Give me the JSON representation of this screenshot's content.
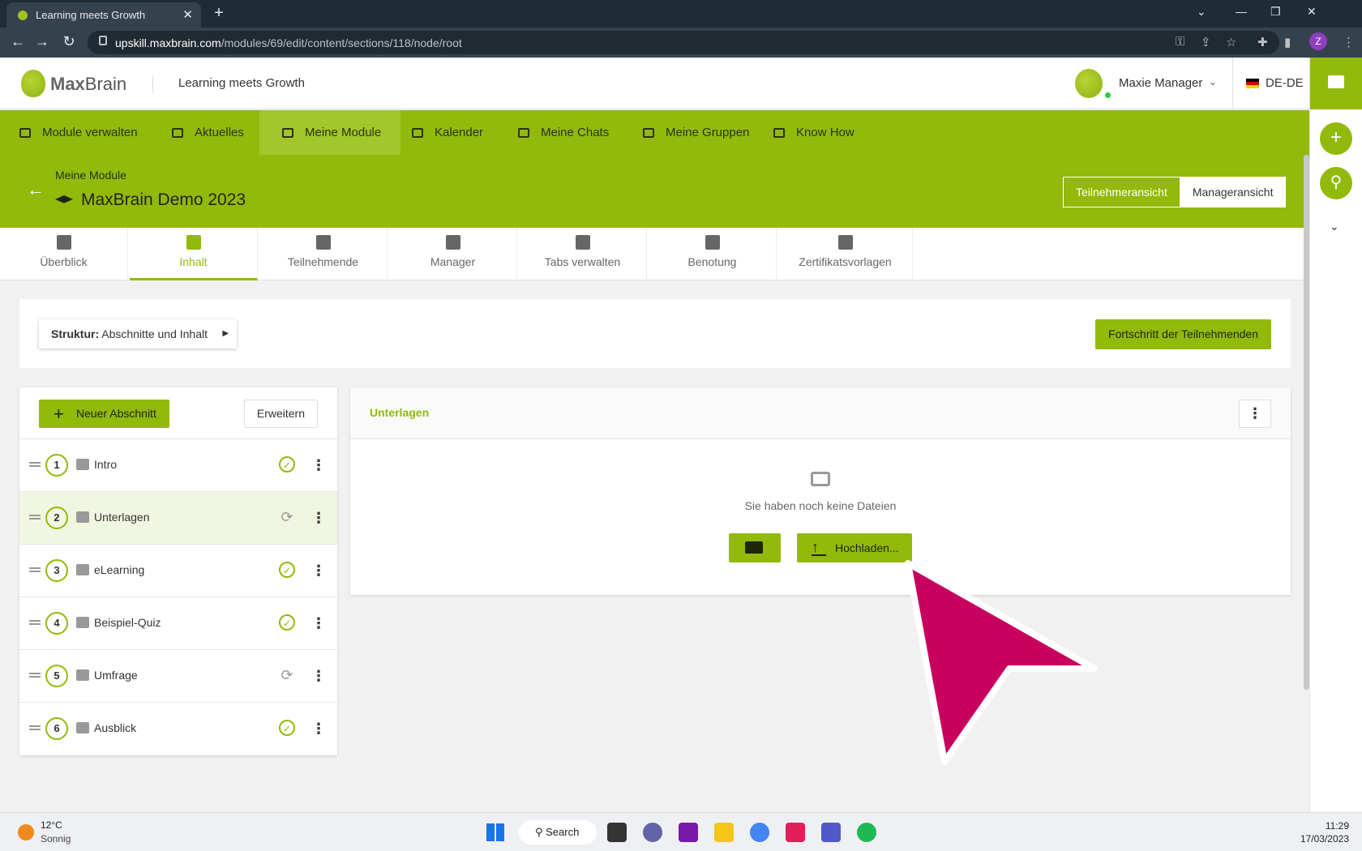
{
  "browser": {
    "tab_title": "Learning meets Growth",
    "url_host": "upskill.maxbrain.com",
    "url_path": "/modules/69/edit/content/sections/118/node/root",
    "profile_initial": "Z"
  },
  "header": {
    "brand_bold": "Max",
    "brand_light": "Brain",
    "subtitle": "Learning meets Growth",
    "user_name": "Maxie Manager",
    "language": "DE-DE"
  },
  "nav": {
    "items": [
      {
        "label": "Module verwalten"
      },
      {
        "label": "Aktuelles"
      },
      {
        "label": "Meine Module"
      },
      {
        "label": "Kalender"
      },
      {
        "label": "Meine Chats"
      },
      {
        "label": "Meine Gruppen"
      },
      {
        "label": "Know How"
      }
    ]
  },
  "module": {
    "breadcrumb": "Meine Module",
    "title": "MaxBrain Demo 2023",
    "view_participant": "Teilnehmeransicht",
    "view_manager": "Manageransicht"
  },
  "tabs": [
    {
      "label": "Überblick"
    },
    {
      "label": "Inhalt"
    },
    {
      "label": "Teilnehmende"
    },
    {
      "label": "Manager"
    },
    {
      "label": "Tabs verwalten"
    },
    {
      "label": "Benotung"
    },
    {
      "label": "Zertifikatsvorlagen"
    }
  ],
  "structure": {
    "label_bold": "Struktur:",
    "label_value": "Abschnitte und Inhalt",
    "progress_button": "Fortschritt der Teilnehmenden"
  },
  "sections": {
    "new_button": "Neuer Abschnitt",
    "expand_button": "Erweitern",
    "items": [
      {
        "num": "1",
        "label": "Intro",
        "status": "done"
      },
      {
        "num": "2",
        "label": "Unterlagen",
        "status": "sync"
      },
      {
        "num": "3",
        "label": "eLearning",
        "status": "done"
      },
      {
        "num": "4",
        "label": "Beispiel-Quiz",
        "status": "done"
      },
      {
        "num": "5",
        "label": "Umfrage",
        "status": "sync"
      },
      {
        "num": "6",
        "label": "Ausblick",
        "status": "done"
      }
    ]
  },
  "detail": {
    "title": "Unterlagen",
    "empty_text": "Sie haben noch keine Dateien",
    "upload_button": "Hochladen..."
  },
  "taskbar": {
    "temperature": "12°C",
    "weather": "Sonnig",
    "search": "Search",
    "time": "11:29",
    "date": "17/03/2023"
  },
  "colors": {
    "accent": "#93b90c",
    "cursor": "#c8005f"
  }
}
